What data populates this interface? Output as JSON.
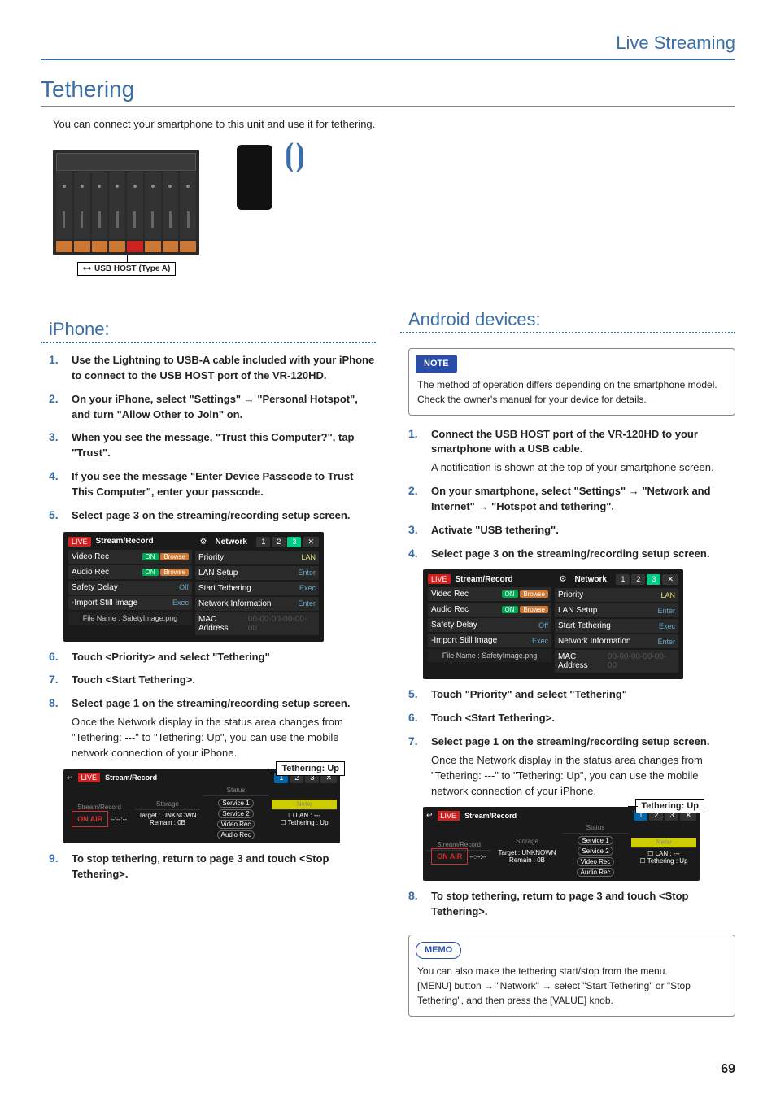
{
  "header": {
    "section": "Live Streaming"
  },
  "title": "Tethering",
  "intro": "You can connect your smartphone to this unit and use it for tethering.",
  "usb_label": "USB HOST (Type A)",
  "page_number": "69",
  "iphone": {
    "heading": "iPhone:",
    "steps": [
      {
        "n": "1.",
        "bold": "Use the Lightning to USB-A cable included with your iPhone to connect to the USB HOST port of the VR-120HD."
      },
      {
        "n": "2.",
        "bold": "On your iPhone, select \"Settings\" → \"Personal Hotspot\", and turn \"Allow Other to Join\" on."
      },
      {
        "n": "3.",
        "bold": "When you see the message, \"Trust this Computer?\", tap \"Trust\"."
      },
      {
        "n": "4.",
        "bold": "If you see the message \"Enter Device Passcode to Trust This Computer\", enter your passcode."
      },
      {
        "n": "5.",
        "bold": "Select page 3 on the streaming/recording setup screen."
      },
      {
        "n": "6.",
        "bold": "Touch <Priority> and select \"Tethering\""
      },
      {
        "n": "7.",
        "bold": "Touch <Start Tethering>."
      },
      {
        "n": "8.",
        "bold": "Select page 1 on the streaming/recording setup screen.",
        "sub": "Once the Network display in the status area changes from \"Tethering: ---\" to \"Tethering: Up\", you can use the mobile network connection of your iPhone."
      },
      {
        "n": "9.",
        "bold": "To stop tethering, return to page 3 and touch <Stop Tethering>."
      }
    ]
  },
  "android": {
    "heading": "Android devices:",
    "note_tag": "NOTE",
    "note_body": "The method of operation differs depending on the smartphone model. Check the owner's manual for your device for details.",
    "steps": [
      {
        "n": "1.",
        "bold": "Connect the USB HOST port of the VR-120HD to your smartphone with a USB cable.",
        "sub": "A notification is shown at the top of your smartphone screen."
      },
      {
        "n": "2.",
        "bold": "On your smartphone, select \"Settings\" → \"Network and Internet\" → \"Hotspot and tethering\"."
      },
      {
        "n": "3.",
        "bold": "Activate \"USB tethering\"."
      },
      {
        "n": "4.",
        "bold": "Select page 3 on the streaming/recording setup screen."
      },
      {
        "n": "5.",
        "bold": "Touch \"Priority\" and select \"Tethering\""
      },
      {
        "n": "6.",
        "bold": "Touch <Start Tethering>."
      },
      {
        "n": "7.",
        "bold": "Select page 1 on the streaming/recording setup screen.",
        "sub": "Once the Network display in the status area changes from \"Tethering: ---\" to \"Tethering: Up\", you can use the mobile network connection of your iPhone."
      },
      {
        "n": "8.",
        "bold": "To stop tethering, return to page 3 and touch <Stop Tethering>."
      }
    ],
    "memo_tag": "MEMO",
    "memo_line1": "You can also make the tethering start/stop from the menu.",
    "memo_line2": "[MENU] button → \"Network\" → select \"Start Tethering\" or \"Stop Tethering\", and then press the [VALUE] knob."
  },
  "panel": {
    "stream_record": "Stream/Record",
    "network": "Network",
    "video_rec": "Video Rec",
    "audio_rec": "Audio Rec",
    "safety_delay": "Safety Delay",
    "import_still": "-Import Still Image",
    "file_name": "File Name : SafetyImage.png",
    "on": "ON",
    "browse": "Browse",
    "off": "Off",
    "exec": "Exec",
    "priority": "Priority",
    "lan": "LAN",
    "lan_setup": "LAN Setup",
    "enter": "Enter",
    "start_tethering": "Start Tethering",
    "net_info": "Network Information",
    "mac_address": "MAC Address",
    "mac_val": "00-00-00-00-00-00",
    "tabs": {
      "t1": "1",
      "t2": "2",
      "t3": "3"
    }
  },
  "status": {
    "callout": "Tethering: Up",
    "title": "Stream/Record",
    "col_stream": "Stream/Record",
    "col_storage": "Storage",
    "col_status": "Status",
    "col_network": "Netw",
    "onair": "ON AIR",
    "timecode": "--:--:--",
    "target": "Target : UNKNOWN",
    "remain": "Remain : 0B",
    "service1": "Service 1",
    "service2": "Service 2",
    "videorec": "Video Rec",
    "audiorec": "Audio Rec",
    "lan_label": "LAN :",
    "teth_label": "Tethering :",
    "up": "Up",
    "dash": "---"
  }
}
